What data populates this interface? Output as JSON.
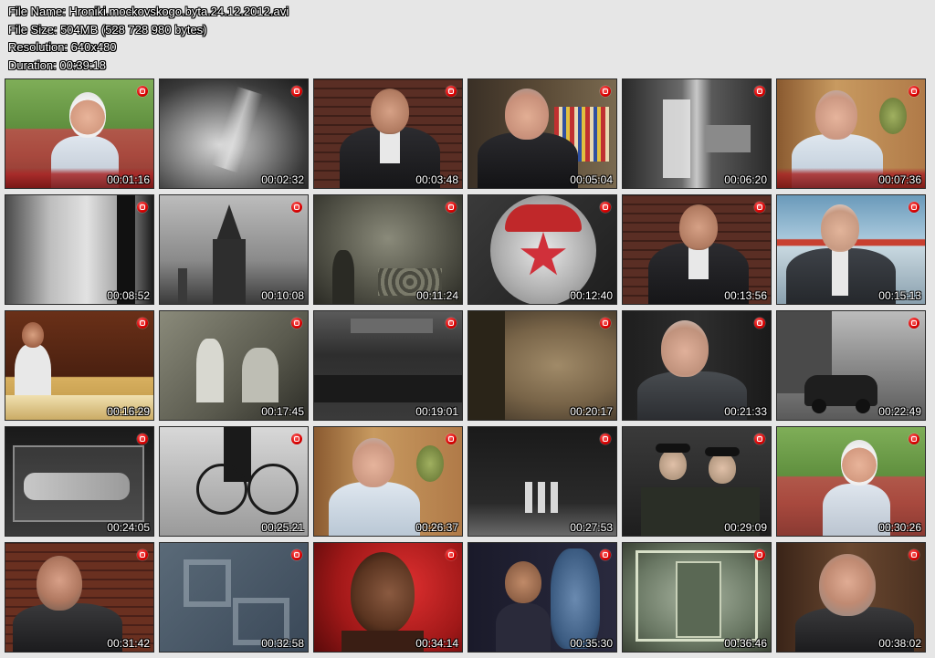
{
  "header": {
    "file_name": "File Name: Hroniki.mockovskogo.byta.24.12.2012.avi",
    "file_size": "File Size: 504MB (528 728 980 bytes)",
    "resolution": "Resolution: 640x480",
    "duration": "Duration: 00:39:18"
  },
  "thumbnails": [
    {
      "time": "00:01:16",
      "scene": "man-white-hair-outdoor"
    },
    {
      "time": "00:02:32",
      "scene": "archive-blur"
    },
    {
      "time": "00:03:48",
      "scene": "man-dark-suit-brick"
    },
    {
      "time": "00:05:04",
      "scene": "old-man-glasses-bookshelf"
    },
    {
      "time": "00:06:20",
      "scene": "archive-room-interior"
    },
    {
      "time": "00:07:36",
      "scene": "old-man-glasses-cafe"
    },
    {
      "time": "00:08:52",
      "scene": "archive-gray-abstract"
    },
    {
      "time": "00:10:08",
      "scene": "kremlin-tower"
    },
    {
      "time": "00:11:24",
      "scene": "archive-crowd-field"
    },
    {
      "time": "00:12:40",
      "scene": "red-star-medal"
    },
    {
      "time": "00:13:56",
      "scene": "man-dark-suit-brick"
    },
    {
      "time": "00:15:13",
      "scene": "man-white-hair-office"
    },
    {
      "time": "00:16:29",
      "scene": "woman-lab-coat"
    },
    {
      "time": "00:17:45",
      "scene": "archive-workers"
    },
    {
      "time": "00:19:01",
      "scene": "archive-mausoleum"
    },
    {
      "time": "00:20:17",
      "scene": "fabric-closeup"
    },
    {
      "time": "00:21:33",
      "scene": "old-man-dark-bg"
    },
    {
      "time": "00:22:49",
      "scene": "street-old-car"
    },
    {
      "time": "00:24:05",
      "scene": "archive-sarcophagus"
    },
    {
      "time": "00:25:21",
      "scene": "kremlin-clock"
    },
    {
      "time": "00:26:37",
      "scene": "old-man-glasses-cafe"
    },
    {
      "time": "00:27:53",
      "scene": "mausoleum-guards"
    },
    {
      "time": "00:29:09",
      "scene": "soldiers-caps"
    },
    {
      "time": "00:30:26",
      "scene": "man-white-hair-outdoor"
    },
    {
      "time": "00:31:42",
      "scene": "man-beard-glasses-brick"
    },
    {
      "time": "00:32:58",
      "scene": "stone-letters"
    },
    {
      "time": "00:34:14",
      "scene": "woman-red-bg"
    },
    {
      "time": "00:35:30",
      "scene": "boy-vase"
    },
    {
      "time": "00:36:46",
      "scene": "archive-door-frame"
    },
    {
      "time": "00:38:02",
      "scene": "man-beard-glasses-room"
    }
  ],
  "colors": {
    "page_bg": "#e6e6e6",
    "channel_logo": "#d90000",
    "text": "#ffffff"
  },
  "icons": {
    "channel_logo": "channel-logo-icon"
  }
}
